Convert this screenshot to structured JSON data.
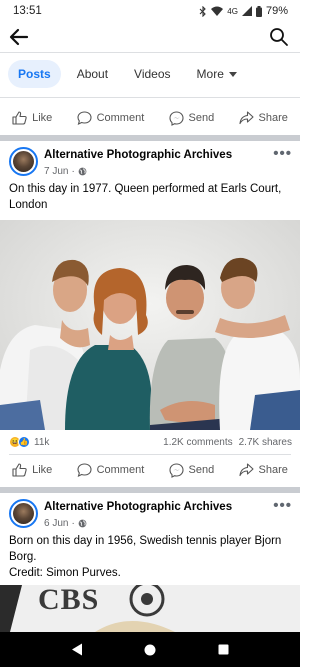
{
  "status": {
    "time": "13:51",
    "network": "4G",
    "battery": "79%"
  },
  "tabs": [
    {
      "label": "Posts"
    },
    {
      "label": "About"
    },
    {
      "label": "Videos"
    },
    {
      "label": "More"
    }
  ],
  "actions": {
    "like": "Like",
    "comment": "Comment",
    "send": "Send",
    "share": "Share"
  },
  "posts": [
    {
      "author": "Alternative Photographic Archives",
      "date": "7 Jun",
      "text": "On this day in 1977. Queen performed at Earls Court, London",
      "reaction_count": "11k",
      "comments": "1.2K comments",
      "shares": "2.7K shares"
    },
    {
      "author": "Alternative Photographic Archives",
      "date": "6 Jun",
      "text": "Born on this day in 1956, Swedish tennis player Bjorn Borg.\nCredit: Simon Purves.",
      "photo_text": "CBS"
    }
  ],
  "icons": {
    "back": "back-arrow-icon",
    "search": "search-icon",
    "more": "more-options-icon",
    "globe": "globe-icon",
    "like": "thumbs-up-icon",
    "comment": "comment-bubble-icon",
    "send": "messenger-icon",
    "share": "share-arrow-icon"
  },
  "colors": {
    "accent": "#1877f2",
    "tab_active_bg": "#e7f0fd",
    "secondary_text": "#65676b",
    "separator": "#c9ccd1"
  }
}
